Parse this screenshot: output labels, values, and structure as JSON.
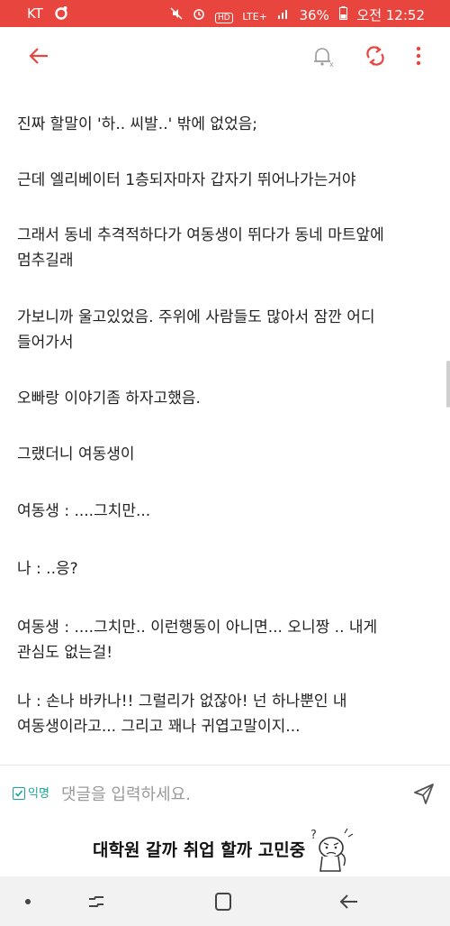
{
  "status_bar": {
    "carrier": "KT",
    "network": "LTE+",
    "battery": "36%",
    "time": "오전 12:52",
    "icons": [
      "notification-icon",
      "mute-icon",
      "alarm-icon",
      "hd-icon",
      "signal-icon",
      "battery-icon"
    ]
  },
  "app_bar": {
    "icons": [
      "back-arrow-icon",
      "notification-off-icon",
      "refresh-icon",
      "more-vertical-icon"
    ],
    "accent": "#e7453d"
  },
  "post": {
    "paragraphs": [
      "진짜 할말이 '하.. 씨발..' 밖에 없었음;",
      "근데 엘리베이터 1층되자마자 갑자기 뛰어나가는거야",
      "그래서 동네 추격적하다가 여동생이 뛰다가 동네 마트앞에\n멈추길래",
      "가보니까 울고있었음. 주위에 사람들도 많아서 잠깐 어디\n들어가서",
      "오빠랑 이야기좀 하자고했음.",
      "그랬더니 여동생이",
      "여동생 : ....그치만...",
      "나 : ..응?",
      "여동생 : ....그치만.. 이런행동이 아니면... 오니짱 .. 내게\n관심도 없는걸!",
      "나 : 손나 바카나!! 그럴리가 없잖아! 넌 하나뿐인 내\n여동생이라고... 그리고 꽤나 귀엽고말이지..."
    ]
  },
  "comment_bar": {
    "anonymous_label": "익명",
    "anonymous_checked": true,
    "placeholder": "댓글을 입력하세요.",
    "accent": "#1aa39a"
  },
  "banner": {
    "text": "대학원 갈까 취업 할까 고민중"
  },
  "nav_bar": {
    "icons": [
      "dot-icon",
      "recent-apps-icon",
      "home-icon",
      "back-icon"
    ]
  }
}
